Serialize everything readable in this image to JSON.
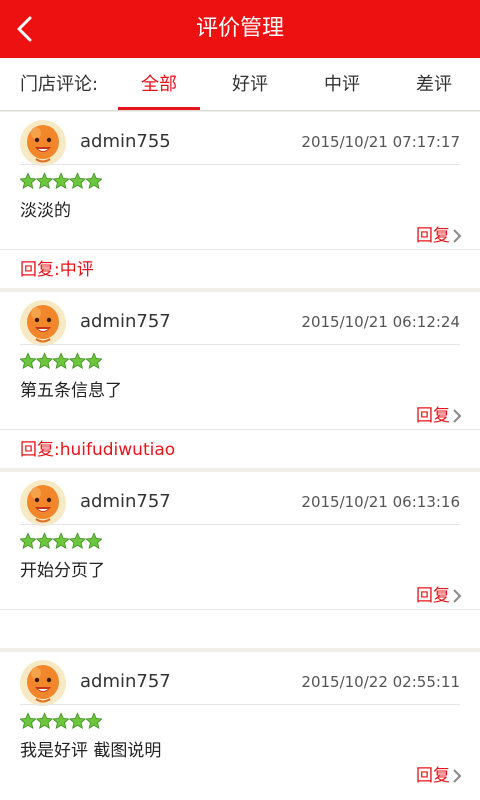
{
  "header": {
    "title": "评价管理"
  },
  "tabs": {
    "label": "门店评论:",
    "items": [
      "全部",
      "好评",
      "中评",
      "差评"
    ],
    "active_index": 0
  },
  "reviews": [
    {
      "username": "admin755",
      "time": "2015/10/21 07:17:17",
      "rating": 5,
      "content": "淡淡的",
      "reply_label": "回复",
      "reply": "回复:中评"
    },
    {
      "username": "admin757",
      "time": "2015/10/21 06:12:24",
      "rating": 5,
      "content": "第五条信息了",
      "reply_label": "回复",
      "reply": "回复:huifudiwutiao"
    },
    {
      "username": "admin757",
      "time": "2015/10/21 06:13:16",
      "rating": 5,
      "content": "开始分页了",
      "reply_label": "回复",
      "reply": ""
    },
    {
      "username": "admin757",
      "time": "2015/10/22 02:55:11",
      "rating": 5,
      "content": "我是好评 截图说明",
      "reply_label": "回复",
      "reply": ""
    }
  ],
  "colors": {
    "header_bg": "#ee1111",
    "accent": "#e8141a",
    "star": "#6cc63d"
  },
  "icons": {
    "back": "chevron-left-icon",
    "avatar": "orange-face-avatar-icon",
    "star": "green-star-icon",
    "reply_arrow": "chevron-right-icon"
  }
}
